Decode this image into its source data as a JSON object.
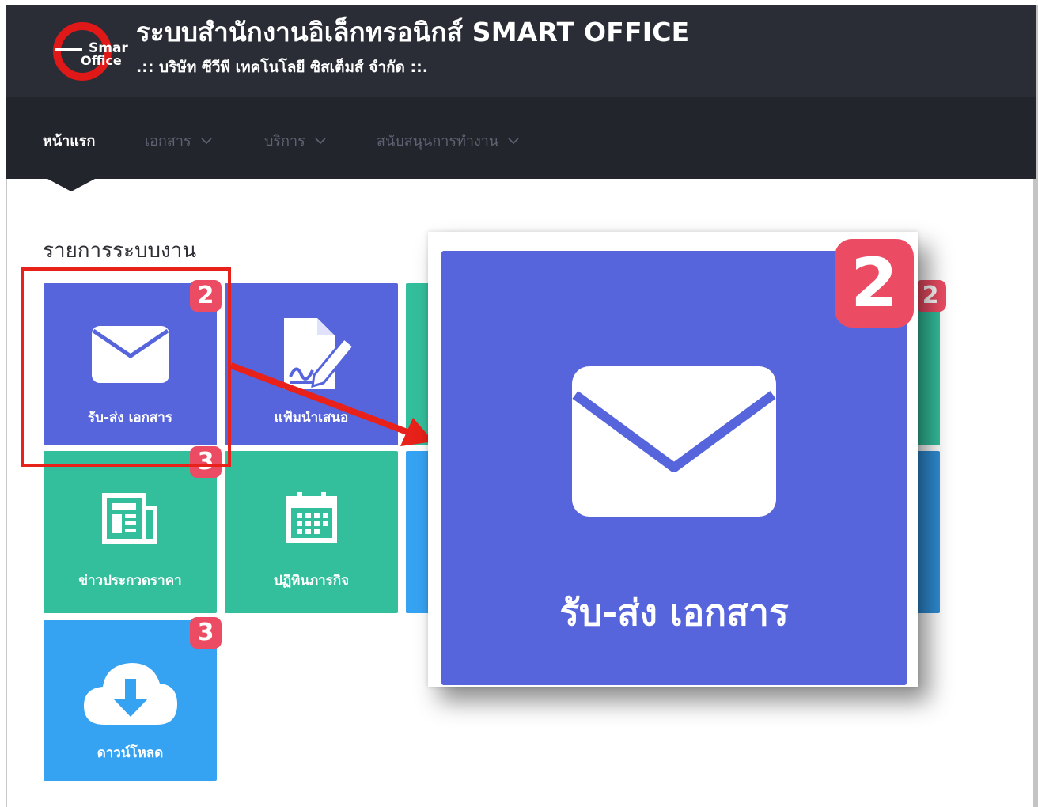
{
  "header": {
    "title": "ระบบสำนักงานอิเล็กทรอนิกส์ SMART OFFICE",
    "subtitle": ".:: บริษัท ซีวีพี เทคโนโลยี ซิสเต็มส์ จำกัด ::.",
    "logo_line1": "Smart",
    "logo_line2": "Office"
  },
  "nav": {
    "items": [
      {
        "label": "หน้าแรก",
        "active": true
      },
      {
        "label": "เอกสาร"
      },
      {
        "label": "บริการ"
      },
      {
        "label": "สนับสนุนการทำงาน"
      }
    ]
  },
  "main": {
    "section_title": "รายการระบบงาน",
    "tiles": [
      {
        "label": "รับ-ส่ง เอกสาร",
        "badge": "2",
        "icon": "envelope-icon",
        "color": "#5765dd"
      },
      {
        "label": "แฟ้มนำเสนอ",
        "icon": "document-sign-icon",
        "color": "#5765dd"
      },
      {
        "label": "ข่าวประกวดราคา",
        "badge": "3",
        "icon": "newspaper-icon",
        "color": "#34bf9c"
      },
      {
        "label": "ปฏิทินภารกิจ",
        "icon": "calendar-icon",
        "color": "#34bf9c"
      },
      {
        "label": "ดาวน์โหลด",
        "badge": "3",
        "icon": "cloud-download-icon",
        "color": "#36a3f2"
      }
    ],
    "hidden_tile_badge": "2"
  },
  "zoom": {
    "label": "รับ-ส่ง เอกสาร",
    "badge": "2"
  },
  "colors": {
    "header_bg": "#2b2d36",
    "nav_bg": "#23252d",
    "purple": "#5765dd",
    "green": "#34bf9c",
    "blue": "#36a3f2",
    "badge": "#ec4c63",
    "annotation": "#e8211a"
  }
}
